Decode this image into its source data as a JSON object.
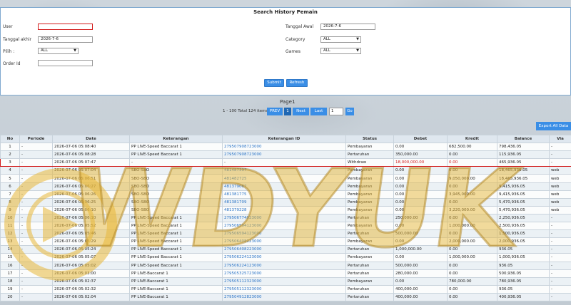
{
  "header": {
    "title": "Search History Pemain"
  },
  "form": {
    "user_label": "User",
    "user_value": "",
    "tanggal_awal_label": "Tanggal Awal",
    "tanggal_awal_value": "2026-7-6",
    "tanggal_akhir_label": "Tanggal akhir",
    "tanggal_akhir_value": "2026-7-6",
    "category_label": "Category",
    "category_value": "ALL",
    "pilih_label": "Pilih :",
    "pilih_value": "ALL",
    "games_label": "Games",
    "games_value": "ALL",
    "order_id_label": "Order Id",
    "order_id_value": "",
    "submit_label": "Submit",
    "refresh_label": "Refresh"
  },
  "pager": {
    "page_label": "Page1",
    "total_text": "1 - 100 Total 124 items",
    "prev_label": "PREV",
    "current": "1",
    "next_label": "Next",
    "last_label": "Last",
    "goto_value": "1",
    "go_label": "Go"
  },
  "toolbar": {
    "export_label": "Export All Data"
  },
  "table": {
    "columns": [
      "No",
      "Periode",
      "Date",
      "Keterangan",
      "Keterangan ID",
      "Status",
      "Debet",
      "Kredit",
      "Balance",
      "Via"
    ],
    "rows": [
      {
        "no": "1",
        "periode": "-",
        "date": "2026-07-06 05:08:40",
        "ket": "PP LIVE-Speed Baccarat 1",
        "ket_id": "279507908723000",
        "status": "Pembayaran",
        "debet": "0.00",
        "kredit": "682,500.00",
        "balance": "798,436.05",
        "via": "-"
      },
      {
        "no": "2",
        "periode": "-",
        "date": "2026-07-06 05:08:28",
        "ket": "PP LIVE-Speed Baccarat 1",
        "ket_id": "279507908723000",
        "status": "Pertaruhan",
        "debet": "350,000.00",
        "kredit": "0.00",
        "balance": "115,936.05",
        "via": "-"
      },
      {
        "no": "3",
        "periode": "-",
        "date": "2026-07-06 05:07:47",
        "ket": "-",
        "ket_id": "-",
        "status": "Withdraw",
        "debet": "18,000,000.00",
        "kredit": "0.00",
        "balance": "465,936.05",
        "via": "-"
      },
      {
        "no": "4",
        "periode": "-",
        "date": "2026-07-06 05:07:04",
        "ket": "SBO-SBO",
        "ket_id": "481487397",
        "status": "Pembayaran",
        "debet": "0.00",
        "kredit": "0.00",
        "balance": "18,465,936.05",
        "via": "web"
      },
      {
        "no": "5",
        "periode": "-",
        "date": "2026-07-06 05:06:51",
        "ket": "SBO-SBO",
        "ket_id": "481482725",
        "status": "Pembayaran",
        "debet": "0.00",
        "kredit": "9,050,000.00",
        "balance": "18,465,936.05",
        "via": "web"
      },
      {
        "no": "6",
        "periode": "-",
        "date": "2026-07-06 05:06:27",
        "ket": "SBO-SBO",
        "ket_id": "481379067",
        "status": "Pembayaran",
        "debet": "0.00",
        "kredit": "0.00",
        "balance": "9,415,936.05",
        "via": "web"
      },
      {
        "no": "7",
        "periode": "-",
        "date": "2026-07-06 05:06:26",
        "ket": "SBO-SBO",
        "ket_id": "481381775",
        "status": "Pembayaran",
        "debet": "0.00",
        "kredit": "3,945,000.00",
        "balance": "9,415,936.05",
        "via": "web"
      },
      {
        "no": "8",
        "periode": "-",
        "date": "2026-07-06 05:06:25",
        "ket": "SBO-SBO",
        "ket_id": "481381709",
        "status": "Pembayaran",
        "debet": "0.00",
        "kredit": "0.00",
        "balance": "5,470,936.05",
        "via": "web"
      },
      {
        "no": "9",
        "periode": "-",
        "date": "2026-07-06 05:06:10",
        "ket": "SBO-SBO",
        "ket_id": "481379228",
        "status": "Pembayaran",
        "debet": "0.00",
        "kredit": "3,220,000.00",
        "balance": "5,470,936.05",
        "via": "web"
      },
      {
        "no": "10",
        "periode": "-",
        "date": "2026-07-06 05:06:10",
        "ket": "PP LIVE-Speed Baccarat 1",
        "ket_id": "279506774023000",
        "status": "Pertaruhan",
        "debet": "250,000.00",
        "kredit": "0.00",
        "balance": "2,250,936.05",
        "via": "-"
      },
      {
        "no": "11",
        "periode": "-",
        "date": "2026-07-06 05:05:52",
        "ket": "PP LIVE-Speed Baccarat 1",
        "ket_id": "279506594123000",
        "status": "Pembayaran",
        "debet": "0.00",
        "kredit": "1,000,000.00",
        "balance": "2,500,936.05",
        "via": "-"
      },
      {
        "no": "12",
        "periode": "-",
        "date": "2026-07-06 05:05:46",
        "ket": "PP LIVE-Speed Baccarat 1",
        "ket_id": "279506594123000",
        "status": "Pertaruhan",
        "debet": "500,000.00",
        "kredit": "0.00",
        "balance": "1,500,936.05",
        "via": "-"
      },
      {
        "no": "13",
        "periode": "-",
        "date": "2026-07-06 05:05:29",
        "ket": "PP LIVE-Speed Baccarat 1",
        "ket_id": "279506408223000",
        "status": "Pembayaran",
        "debet": "0.00",
        "kredit": "2,000,000.00",
        "balance": "2,000,936.05",
        "via": "-"
      },
      {
        "no": "14",
        "periode": "-",
        "date": "2026-07-06 05:05:24",
        "ket": "PP LIVE-Speed Baccarat 1",
        "ket_id": "279506408223000",
        "status": "Pertaruhan",
        "debet": "1,000,000.00",
        "kredit": "0.00",
        "balance": "936.05",
        "via": "-"
      },
      {
        "no": "15",
        "periode": "-",
        "date": "2026-07-06 05:05:07",
        "ket": "PP LIVE-Speed Baccarat 1",
        "ket_id": "279506224123000",
        "status": "Pembayaran",
        "debet": "0.00",
        "kredit": "1,000,000.00",
        "balance": "1,000,936.05",
        "via": "-"
      },
      {
        "no": "16",
        "periode": "-",
        "date": "2026-07-06 05:05:02",
        "ket": "PP LIVE-Speed Baccarat 1",
        "ket_id": "279506224123000",
        "status": "Pertaruhan",
        "debet": "500,000.00",
        "kredit": "0.00",
        "balance": "936.05",
        "via": "-"
      },
      {
        "no": "17",
        "periode": "-",
        "date": "2026-07-06 05:03:00",
        "ket": "PP LIVE-Baccarat 1",
        "ket_id": "279505325723000",
        "status": "Pertaruhan",
        "debet": "280,000.00",
        "kredit": "0.00",
        "balance": "500,936.05",
        "via": "-"
      },
      {
        "no": "18",
        "periode": "-",
        "date": "2026-07-06 05:02:37",
        "ket": "PP LIVE-Baccarat 1",
        "ket_id": "279505112323000",
        "status": "Pembayaran",
        "debet": "0.00",
        "kredit": "780,000.00",
        "balance": "780,936.05",
        "via": "-"
      },
      {
        "no": "19",
        "periode": "-",
        "date": "2026-07-06 05:02:32",
        "ket": "PP LIVE-Baccarat 1",
        "ket_id": "279505112323000",
        "status": "Pertaruhan",
        "debet": "400,000.00",
        "kredit": "0.00",
        "balance": "936.05",
        "via": "-"
      },
      {
        "no": "20",
        "periode": "-",
        "date": "2026-07-06 05:02:04",
        "ket": "PP LIVE-Baccarat 1",
        "ket_id": "279504912823000",
        "status": "Pertaruhan",
        "debet": "400,000.00",
        "kredit": "0.00",
        "balance": "400,936.05",
        "via": "-"
      }
    ]
  },
  "watermark": {
    "text": "WDYUK"
  },
  "colors": {
    "accent": "#3a8ee6",
    "highlight": "#d21a1a",
    "link": "#2a73c6",
    "watermark": "#e8b83a"
  }
}
